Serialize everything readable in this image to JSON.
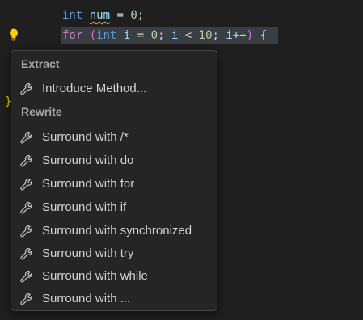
{
  "editor": {
    "line1": {
      "type_kw": "int",
      "var": "num",
      "op": " = ",
      "value": "0",
      "end": ";"
    },
    "line2": {
      "for_kw": "for",
      "open_paren": "(",
      "type_kw": "int",
      "var_i": "i",
      "init": " = ",
      "init_val": "0",
      "sep1": "; ",
      "cond_var": "i",
      "cond_op": " < ",
      "cond_val": "10",
      "sep2": "; ",
      "inc": "i++",
      "close_paren": ")",
      "open_brace": "{"
    },
    "closing_brace": "}"
  },
  "menu": {
    "sections": [
      {
        "label": "Extract",
        "items": [
          {
            "label": "Introduce Method...",
            "icon": "wrench-icon"
          }
        ]
      },
      {
        "label": "Rewrite",
        "items": [
          {
            "label": "Surround with /*",
            "icon": "wrench-icon"
          },
          {
            "label": "Surround with do",
            "icon": "wrench-icon"
          },
          {
            "label": "Surround with for",
            "icon": "wrench-icon"
          },
          {
            "label": "Surround with if",
            "icon": "wrench-icon"
          },
          {
            "label": "Surround with synchronized",
            "icon": "wrench-icon"
          },
          {
            "label": "Surround with try",
            "icon": "wrench-icon"
          },
          {
            "label": "Surround with while",
            "icon": "wrench-icon"
          },
          {
            "label": "Surround with ...",
            "icon": "wrench-icon"
          }
        ]
      }
    ]
  },
  "colors": {
    "background": "#1f1f1f",
    "menu_background": "#252526",
    "keyword": "#569cd6",
    "control_keyword": "#c586c0",
    "variable": "#9cdcfe",
    "number": "#b5cea8",
    "bulb": "#ffcc00"
  }
}
